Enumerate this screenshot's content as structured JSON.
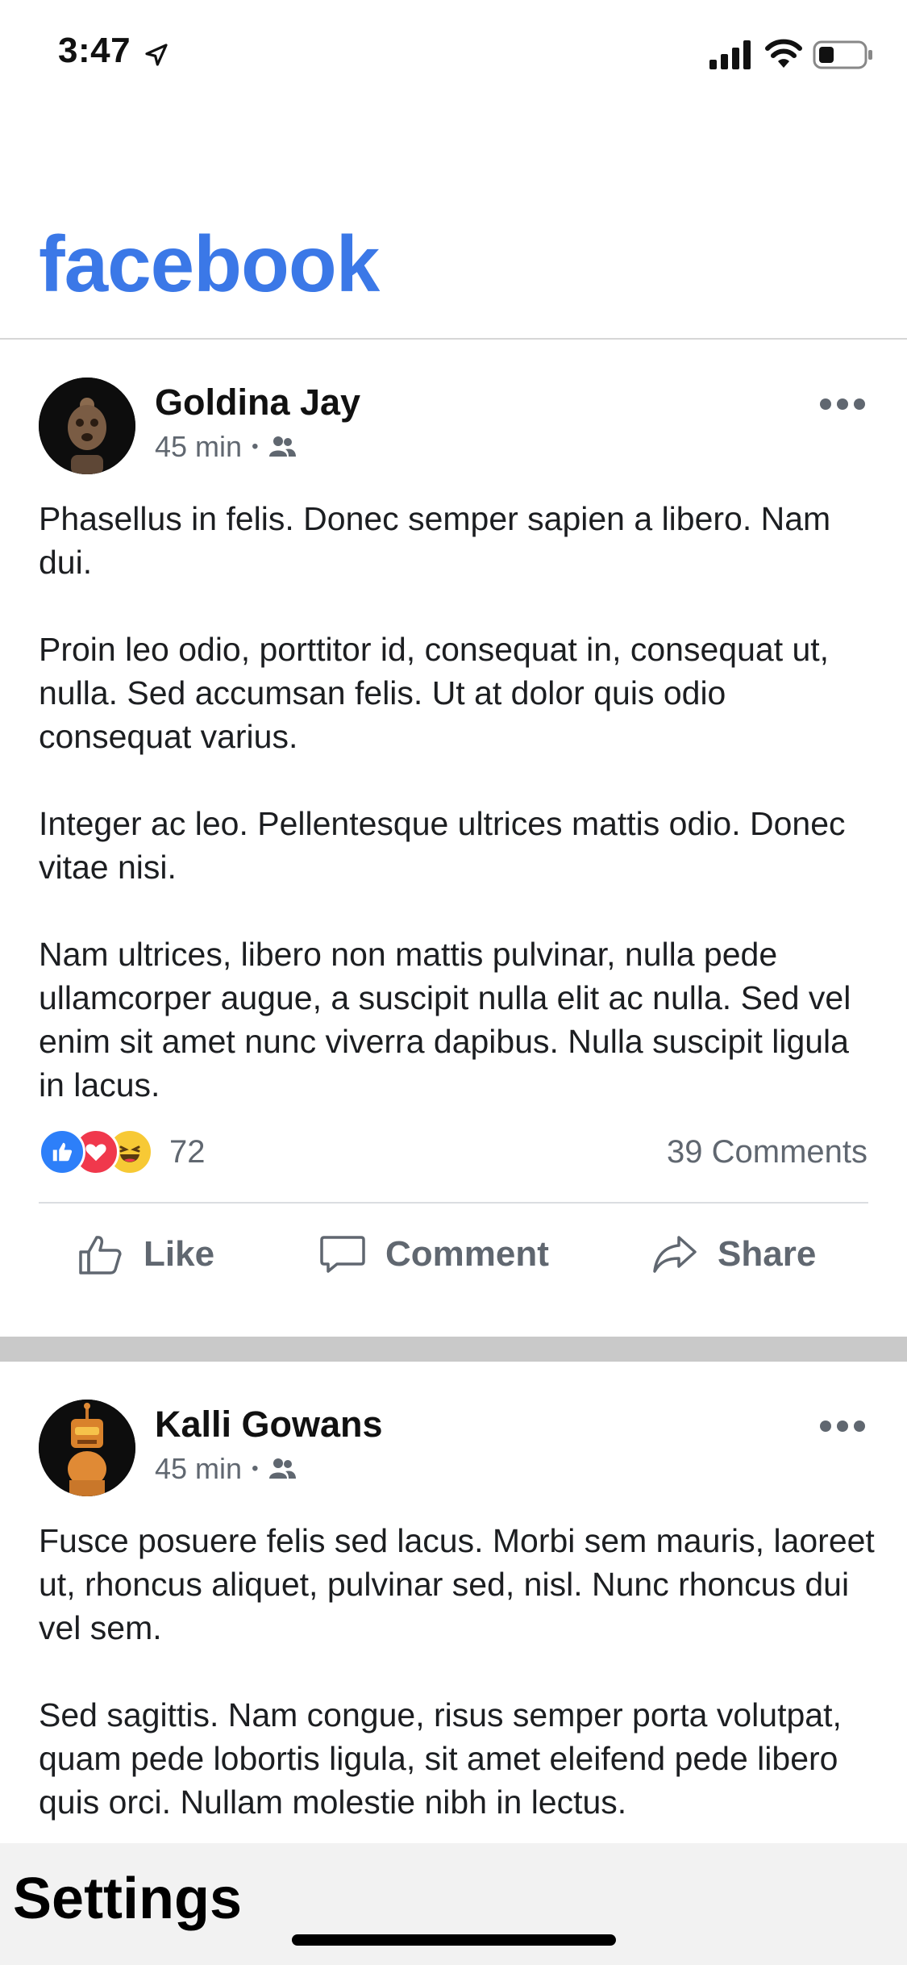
{
  "status_bar": {
    "time": "3:47",
    "icons": [
      "location-arrow-icon",
      "signal-icon",
      "wifi-icon",
      "battery-icon"
    ]
  },
  "header": {
    "logo_text": "facebook",
    "logo_color": "#3b78e7"
  },
  "posts": [
    {
      "author": "Goldina Jay",
      "time": "45 min",
      "audience_icon": "friends-icon",
      "paragraphs": [
        "Phasellus in felis. Donec semper sapien a libero. Nam dui.",
        "Proin leo odio, porttitor id, consequat in, consequat ut, nulla. Sed accumsan felis. Ut at dolor quis odio consequat varius.",
        "Integer ac leo. Pellentesque ultrices mattis odio. Donec vitae nisi.",
        "Nam ultrices, libero non mattis pulvinar, nulla pede ullamcorper augue, a suscipit nulla elit ac nulla. Sed vel enim sit amet nunc viverra dapibus. Nulla suscipit ligula in lacus."
      ],
      "reaction_count": "72",
      "comments_label": "39 Comments",
      "actions": {
        "like": "Like",
        "comment": "Comment",
        "share": "Share"
      }
    },
    {
      "author": "Kalli Gowans",
      "time": "45 min",
      "audience_icon": "friends-icon",
      "paragraphs": [
        "Fusce posuere felis sed lacus. Morbi sem mauris, laoreet ut, rhoncus aliquet, pulvinar sed, nisl. Nunc rhoncus dui vel sem.",
        "Sed sagittis. Nam congue, risus semper porta volutpat, quam pede lobortis ligula, sit amet eleifend pede libero quis orci. Nullam molestie nibh in lectus."
      ]
    }
  ],
  "bottom_bar": {
    "label": "Settings"
  },
  "colors": {
    "like_blue": "#2d7ff9",
    "love_red": "#f0384c",
    "haha_yellow": "#f7c935",
    "secondary_text": "#606770"
  }
}
